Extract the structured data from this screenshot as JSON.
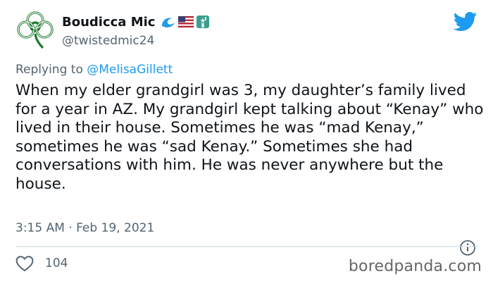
{
  "author": {
    "name": "Boudicca Mic",
    "handle": "@twistedmic24",
    "badges": [
      "wave-icon",
      "us-flag-icon",
      "statue-of-liberty-icon"
    ]
  },
  "reply": {
    "prefix": "Replying to",
    "mention": "@MelisaGillett"
  },
  "tweet": {
    "text": "When my elder grandgirl was 3, my daughter’s family lived for a year in AZ. My grandgirl kept talking about “Kenay” who lived in their house. Sometimes he was “mad Kenay,” sometimes he was “sad Kenay.” Sometimes she had conversations with him. He was never anywhere but the house.",
    "timestamp": "3:15 AM · Feb 19, 2021"
  },
  "stats": {
    "likes": "104"
  },
  "watermark": "boredpanda.com",
  "colors": {
    "twitter_blue": "#1d9bf0",
    "avatar_green": "#1f7a32",
    "secondary_text": "#536471"
  }
}
